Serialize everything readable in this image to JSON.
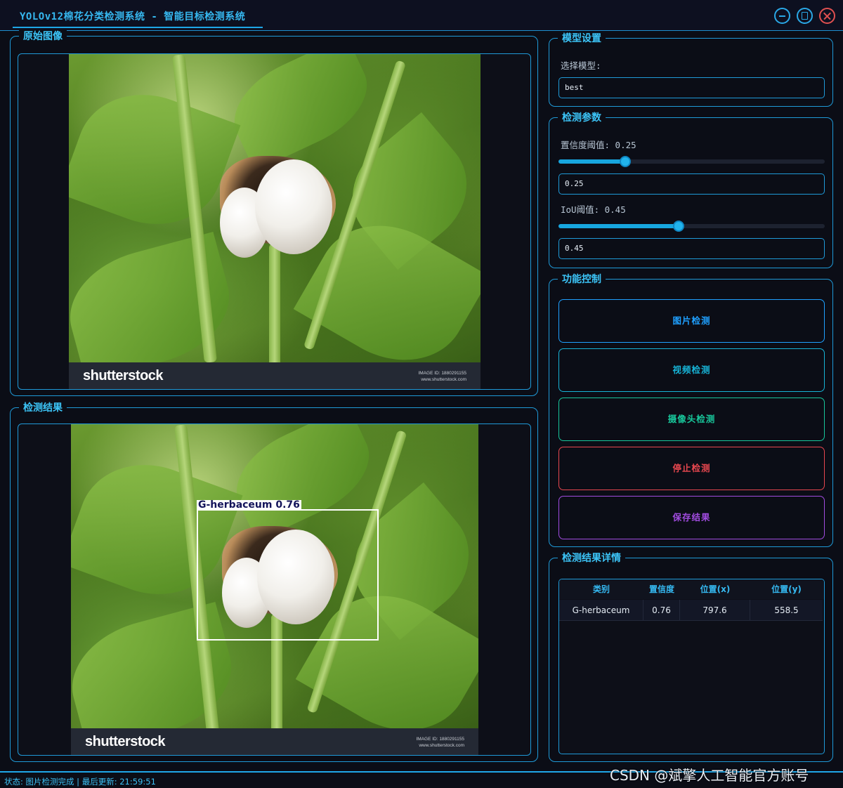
{
  "window": {
    "title": "YOLOv12棉花分类检测系统 - 智能目标检测系统",
    "min_icon": "minimize-icon",
    "max_icon": "maximize-icon",
    "close_icon": "close-icon"
  },
  "original_panel": {
    "title": "原始图像",
    "watermark_logo": "shutterstock",
    "watermark_id": "IMAGE ID: 1880291155",
    "watermark_site": "www.shutterstock.com"
  },
  "result_panel": {
    "title": "检测结果",
    "detection_label": "G-herbaceum 0.76",
    "watermark_logo": "shutterstock",
    "watermark_id": "IMAGE ID: 1880291155",
    "watermark_site": "www.shutterstock.com"
  },
  "model_settings": {
    "title": "模型设置",
    "select_label": "选择模型:",
    "selected_model": "best"
  },
  "detect_params": {
    "title": "检测参数",
    "conf_label": "置信度阈值: 0.25",
    "conf_value": "0.25",
    "conf_level": 0.25,
    "iou_label": "IoU阈值: 0.45",
    "iou_value": "0.45",
    "iou_level": 0.45
  },
  "function_control": {
    "title": "功能控制",
    "buttons": [
      {
        "label": "图片检测",
        "color": "#1fa0ff"
      },
      {
        "label": "视频检测",
        "color": "#17b3d6"
      },
      {
        "label": "摄像头检测",
        "color": "#18c79b"
      },
      {
        "label": "停止检测",
        "color": "#e8474f"
      },
      {
        "label": "保存结果",
        "color": "#a14ce0"
      }
    ]
  },
  "results_detail": {
    "title": "检测结果详情",
    "columns": [
      "类别",
      "置信度",
      "位置(x)",
      "位置(y)"
    ],
    "rows": [
      [
        "G-herbaceum",
        "0.76",
        "797.6",
        "558.5"
      ]
    ]
  },
  "status": {
    "text": "状态: 图片检测完成 | 最后更新: 21:59:51"
  },
  "watermark": {
    "text": "CSDN @斌擎人工智能官方账号"
  },
  "colors": {
    "accent": "#1f9ad8",
    "title": "#3cc4f7",
    "background": "#0b0d16"
  }
}
